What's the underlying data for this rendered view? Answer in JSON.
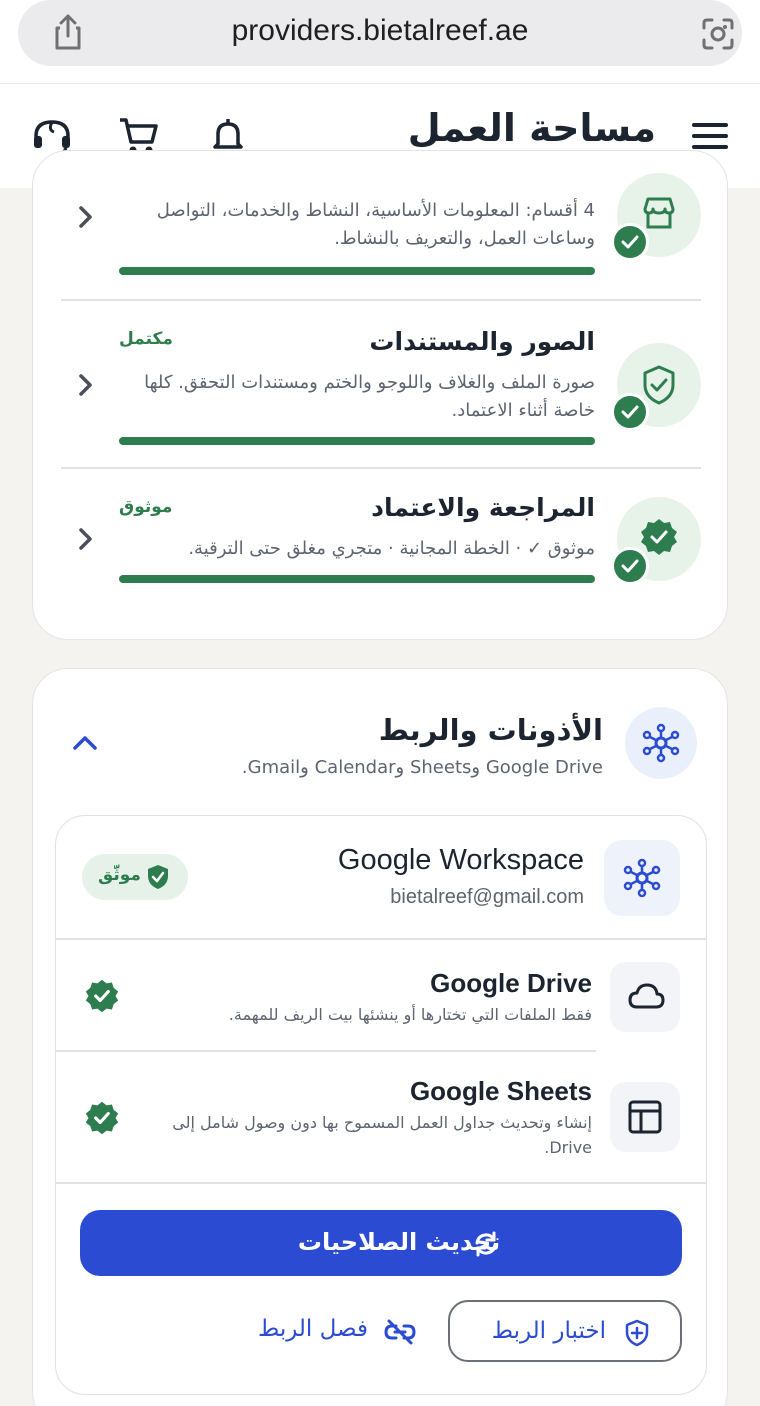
{
  "browser": {
    "url": "providers.bietalreef.ae"
  },
  "header": {
    "title": "مساحة العمل",
    "icons": [
      "menu-icon",
      "bell-icon",
      "cart-icon",
      "support-icon"
    ]
  },
  "onboarding": {
    "rows": [
      {
        "title": "",
        "description": "4 أقسام: المعلومات الأساسية، النشاط والخدمات، التواصل وساعات العمل، والتعريف بالنشاط.",
        "status": "",
        "icon": "store-icon",
        "progress": 1.0
      },
      {
        "title": "الصور والمستندات",
        "description": "صورة الملف والغلاف واللوجو والختم ومستندات التحقق. كلها خاصة أثناء الاعتماد.",
        "status": "مكتمل",
        "icon": "shield-check-icon",
        "progress": 1.0
      },
      {
        "title": "المراجعة والاعتماد",
        "description": "موثوق ✓ · الخطة المجانية · متجري مغلق حتى الترقية.",
        "status": "موثوق",
        "icon": "verified-badge-icon",
        "progress": 1.0
      }
    ]
  },
  "integrations": {
    "title": "الأذونات والربط",
    "subtitle": "Google Drive وSheets وCalendar وGmail.",
    "workspace": {
      "name": "Google Workspace",
      "email": "bietalreef@gmail.com",
      "badge": "موثّق"
    },
    "services": [
      {
        "name": "Google Drive",
        "description": "فقط الملفات التي تختارها أو ينشئها بيت الريف للمهمة.",
        "icon": "cloud-icon",
        "enabled": true
      },
      {
        "name": "Google Sheets",
        "description": "إنشاء وتحديث جداول العمل المسموح بها دون وصول شامل إلى Drive.",
        "icon": "table-icon",
        "enabled": true
      }
    ],
    "refresh_label": "تحديث الصلاحيات",
    "test_label": "اختبار الربط",
    "disconnect_label": "فصل الربط"
  },
  "colors": {
    "brand_green": "#2e7d4f",
    "brand_blue": "#2b4bd2",
    "background": "#f4f3ef"
  }
}
